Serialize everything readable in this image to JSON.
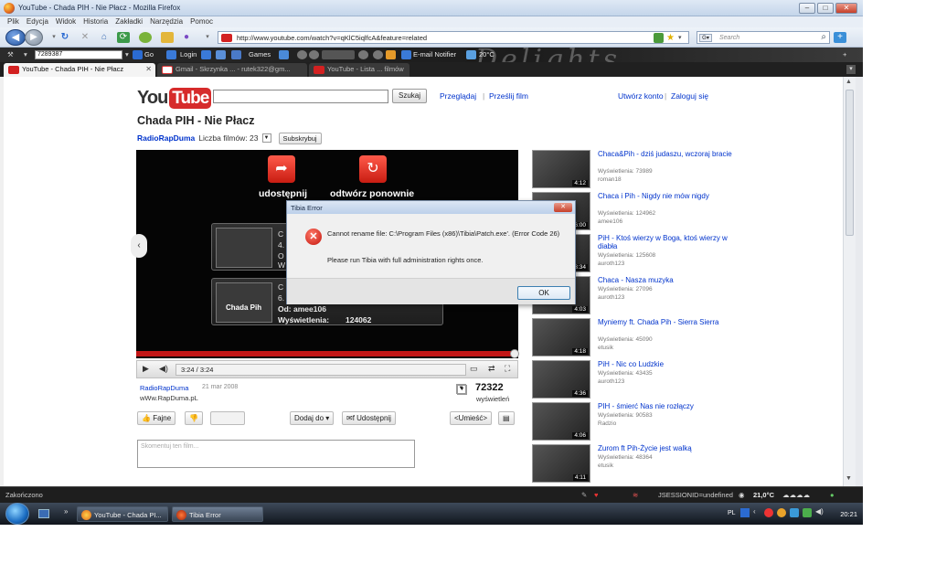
{
  "window": {
    "title": "YouTube - Chada PIH - Nie Płacz - Mozilla Firefox"
  },
  "menu": [
    "Plik",
    "Edycja",
    "Widok",
    "Historia",
    "Zakładki",
    "Narzędzia",
    "Pomoc"
  ],
  "navbar": {
    "url": "http://www.youtube.com/watch?v=qKlC5iqlfcA&feature=related",
    "search_placeholder": "Search"
  },
  "bookmarks": {
    "input_value": "7289387",
    "go": "Go",
    "login": "Login",
    "games": "Games",
    "email": "E-mail Notifier",
    "temp": "20°C",
    "persona_text": "Delights"
  },
  "tabs": [
    {
      "label": "YouTube - Chada PIH - Nie Płacz",
      "active": true
    },
    {
      "label": "Gmail - Skrzynka ... - rutek322@gm...",
      "active": false
    },
    {
      "label": "YouTube - Lista ... filmów",
      "active": false
    }
  ],
  "youtube": {
    "logo_you": "You",
    "logo_tube": "Tube",
    "search_button": "Szukaj",
    "links": [
      "Przeglądaj",
      "Prześlij film"
    ],
    "account": [
      "Utwórz konto",
      "Zaloguj się"
    ],
    "video_title": "Chada PIH - Nie Płacz",
    "channel": "RadioRapDuma",
    "video_count": "Liczba filmów: 23",
    "subscribe": "Subskrybuj",
    "player": {
      "share_label": "udostępnij",
      "replay_label": "odtwórz ponownie",
      "card1": {
        "l1": "C",
        "l2": "4.",
        "l3": "O",
        "l4": "W"
      },
      "card2": {
        "thumb_name": "Chada Pih",
        "l1": "C",
        "l2": "6.",
        "l3": "Od: amee106",
        "views_label": "Wyświetlenia:",
        "views": "124062"
      },
      "time": "3:24 / 3:24"
    },
    "info": {
      "uploader": "RadioRapDuma",
      "date": "21 mar 2008",
      "desc": "wWw.RapDuma.pL"
    },
    "views": {
      "count": "72322",
      "label": "wyświetleń"
    },
    "actions": {
      "like": "Fajne",
      "playlist": "Dodaj do",
      "share": "Udostępnij",
      "embed": "<Umieść>"
    },
    "comment_placeholder": "Skomentuj ten film...",
    "sidebar": [
      {
        "title": "Chaca&Pih - dziś judaszu, wczoraj bracie",
        "views": "Wyświetlenia: 73989",
        "user": "roman18",
        "dur": "4:12"
      },
      {
        "title": "Chaca i Pih - Nigdy nie mów nigdy",
        "views": "Wyświetlenia: 124962",
        "user": "amee106",
        "dur": "6:00"
      },
      {
        "title": "PiH - Ktoś wierzy w Boga, ktoś wierzy w diabła",
        "views": "Wyświetlenia: 125608",
        "user": "auroth123",
        "dur": "3:34"
      },
      {
        "title": "Chaca - Nasza muzyka",
        "views": "Wyświetlenia: 27096",
        "user": "auroth123",
        "dur": "4:03"
      },
      {
        "title": "Myniemy ft. Chada Pih - Sierra Sierra",
        "views": "Wyświetlenia: 45090",
        "user": "etusik",
        "dur": "4:18"
      },
      {
        "title": "PiH - Nic co Ludzkie",
        "views": "Wyświetlenia: 43435",
        "user": "auroth123",
        "dur": "4:36"
      },
      {
        "title": "PIH - śmierć Nas nie rozłączy",
        "views": "Wyświetlenia: 90583",
        "user": "Radzio",
        "dur": "4:06"
      },
      {
        "title": "Zurom ft Pih-Życie jest walką",
        "views": "Wyświetlenia: 48364",
        "user": "etusik",
        "dur": "4:11"
      }
    ]
  },
  "dialog": {
    "title": "Tibia Error",
    "message": "Cannot rename file: C:\\Program Files (x86)\\Tibia\\Patch.exe'. (Error Code 26)",
    "message2": "Please run Tibia with full administration rights once.",
    "ok": "OK"
  },
  "statusbar": {
    "left": "Zakończono",
    "session": "JSESSIONID=undefined",
    "weather": "21,0°C"
  },
  "taskbar": {
    "task1": "YouTube - Chada PI...",
    "task2": "Tibia Error",
    "lang": "PL",
    "time": "20:21"
  }
}
